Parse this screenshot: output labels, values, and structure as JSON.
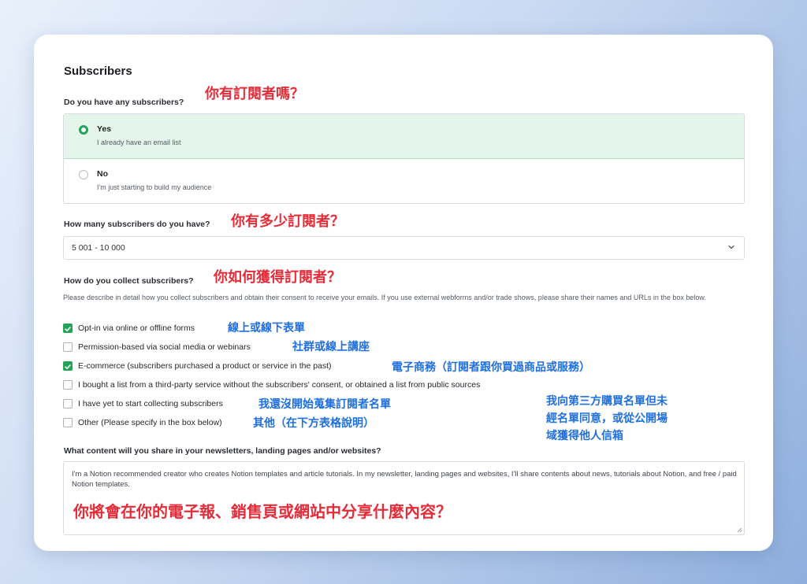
{
  "section_title": "Subscribers",
  "q1": {
    "label": "Do you have any subscribers?",
    "annotation": "你有訂閱者嗎？",
    "options": [
      {
        "label": "Yes",
        "sub": "I already have an email list",
        "selected": true
      },
      {
        "label": "No",
        "sub": "I'm just starting to build my audience",
        "selected": false
      }
    ]
  },
  "q2": {
    "label": "How many subscribers do you have?",
    "annotation": "你有多少訂閱者？",
    "value": "5 001 - 10 000"
  },
  "q3": {
    "label": "How do you collect subscribers?",
    "annotation": "你如何獲得訂閱者？",
    "description": "Please describe in detail how you collect subscribers and obtain their consent to receive your emails. If you use external webforms and/or trade shows, please share their names and URLs in the box below.",
    "options": [
      {
        "label": "Opt-in via online or offline forms",
        "checked": true,
        "annotation": "線上或線下表單"
      },
      {
        "label": "Permission-based via social media or webinars",
        "checked": false,
        "annotation": "社群或線上講座"
      },
      {
        "label": "E-commerce (subscribers purchased a product or service in the past)",
        "checked": true,
        "annotation": "電子商務（訂閱者跟你買過商品或服務）"
      },
      {
        "label": "I bought a list from a third-party service without the subscribers' consent, or obtained a list from public sources",
        "checked": false,
        "annotation": ""
      },
      {
        "label": "I have yet to start collecting subscribers",
        "checked": false,
        "annotation": "我還沒開始蒐集訂閱者名單"
      },
      {
        "label": "Other (Please specify in the box below)",
        "checked": false,
        "annotation": "其他（在下方表格說明）"
      }
    ],
    "bought_list_annotation": [
      "我向第三方購買名單但未",
      "經名單同意，或從公開場",
      "域獲得他人信箱"
    ]
  },
  "q4": {
    "label": "What content will you share in your newsletters, landing pages and/or websites?",
    "value": "I'm a Notion recommended creator who creates Notion templates and article tutorials. In my newsletter, landing pages and websites, I'll share contents about news, tutorials about Notion, and free / paid Notion templates.",
    "annotation": "你將會在你的電子報、銷售頁或網站中分享什麼內容？"
  },
  "colors": {
    "accent_green": "#22a559",
    "annotation_red": "#e52c39",
    "annotation_blue": "#1f6fe0"
  }
}
